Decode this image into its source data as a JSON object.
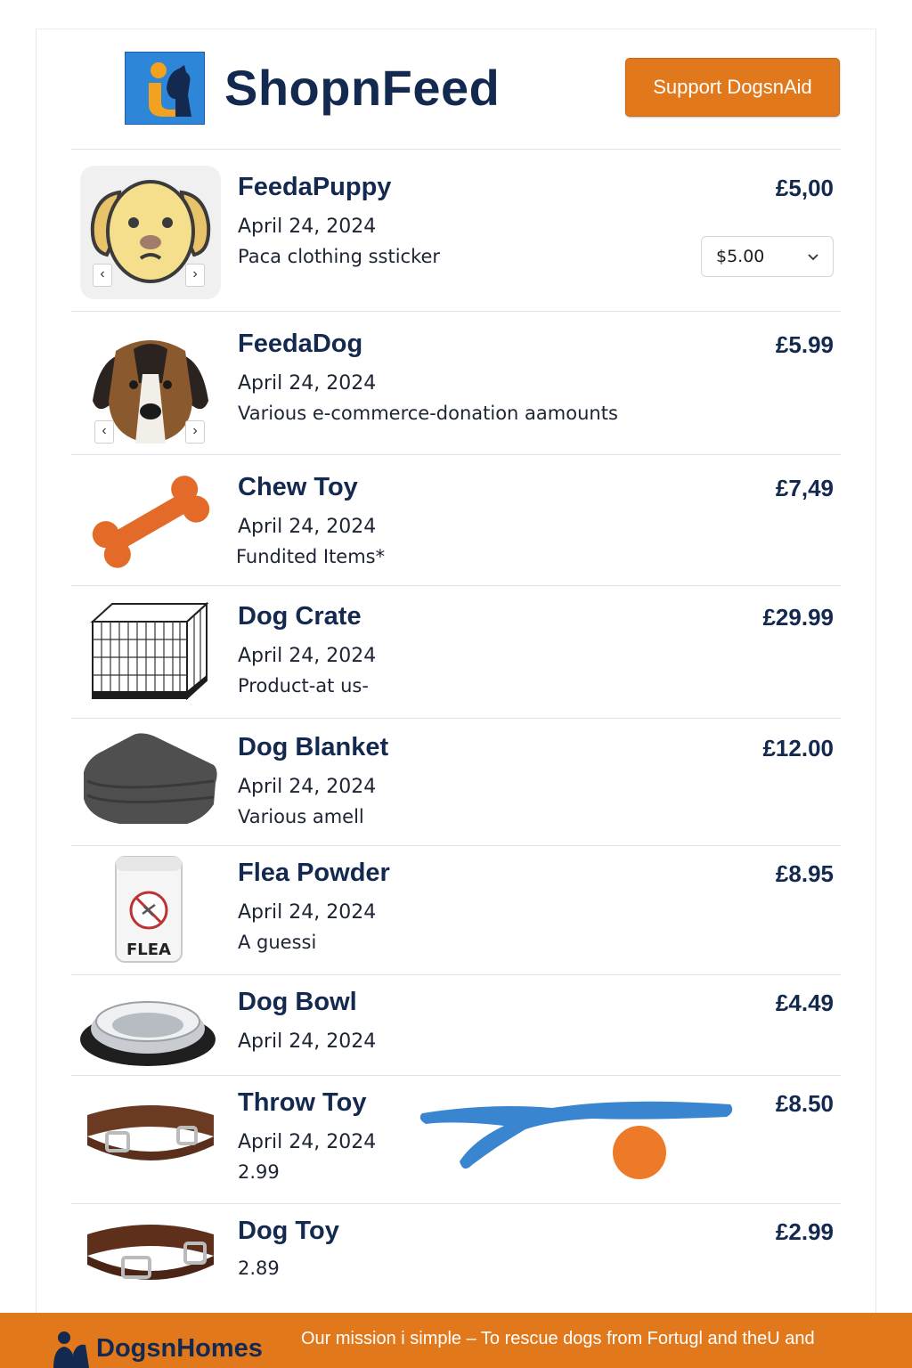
{
  "header": {
    "brand": "ShopnFeed",
    "support_button": "Support DogsnAid"
  },
  "products": [
    {
      "title": "FeedaPuppy",
      "date": "April 24, 2024",
      "description": "Paca clothing ssticker",
      "price": "£5,00",
      "select_value": "$5.00",
      "image": "puppy-face-icon"
    },
    {
      "title": "FeedaDog",
      "date": "April 24, 2024",
      "description": "Various e-commerce-donation aamounts",
      "price": "£5.99",
      "image": "beagle-photo"
    },
    {
      "title": "Chew Toy",
      "date": "April 24, 2024",
      "description": "Fundited Items*",
      "price": "£7,49",
      "image": "bone-chew-toy"
    },
    {
      "title": "Dog Crate",
      "date": "April 24, 2024",
      "description": "Product-at us-",
      "price": "£29.99",
      "image": "wire-crate"
    },
    {
      "title": "Dog Blanket",
      "date": "April 24, 2024",
      "description": "Various amell",
      "price": "£12.00",
      "image": "folded-blanket"
    },
    {
      "title": "Flea Powder",
      "date": "April 24, 2024",
      "description": "A guessi",
      "price": "£8.95",
      "image_label": "FLEA",
      "image": "flea-powder-jar"
    },
    {
      "title": "Dog Bowl",
      "date": "April 24, 2024",
      "price": "£4.49",
      "image": "steel-bowl"
    },
    {
      "title": "Throw Toy",
      "date": "April 24, 2024",
      "description": "2.99",
      "price": "£8.50",
      "image": "leather-collar"
    },
    {
      "title": "Dog Toy",
      "description": "2.89",
      "price": "£2.99",
      "image": "leather-collar"
    }
  ],
  "footer": {
    "brand": "DogsnHomes",
    "mission": "Our mission i simple – To rescue dogs from Fortugl and theU and"
  },
  "colors": {
    "accent": "#e2781c",
    "navy": "#13294f",
    "logo_blue": "#2e86d8"
  }
}
